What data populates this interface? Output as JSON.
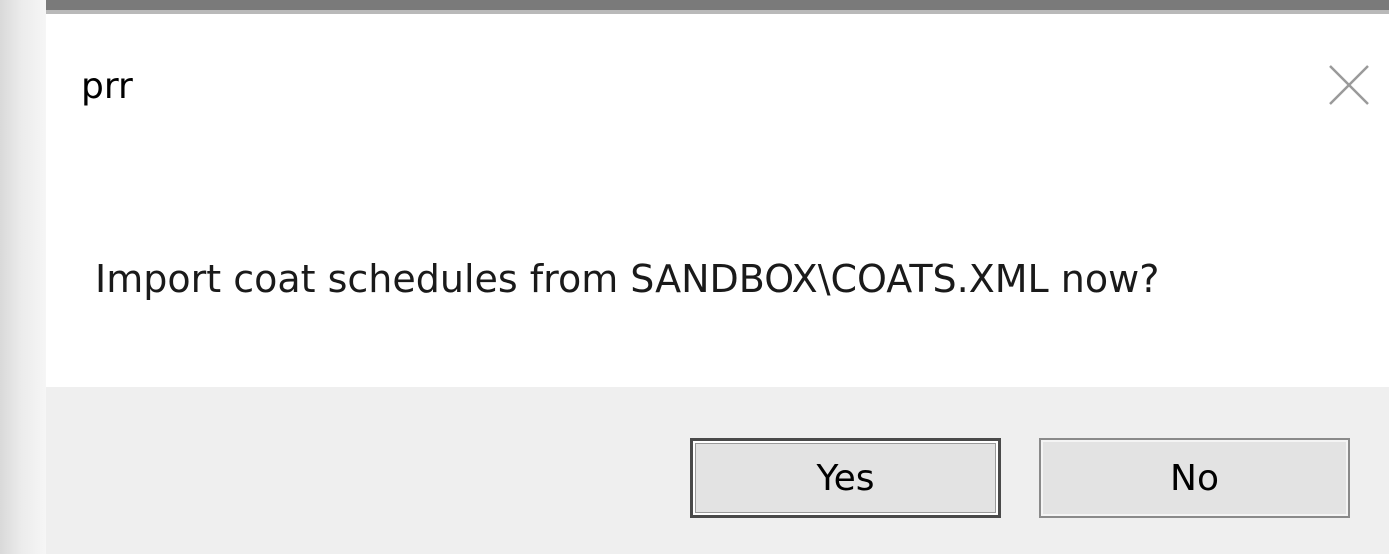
{
  "dialog": {
    "title": "prr",
    "close_icon": "close-icon",
    "message": "Import coat schedules from SANDBOX\\COATS.XML now?",
    "buttons": {
      "yes_label": "Yes",
      "no_label": "No"
    }
  },
  "colors": {
    "footer_bg": "#efefef",
    "button_bg": "#e3e3e3",
    "title_bar": "#7a7a7a"
  }
}
